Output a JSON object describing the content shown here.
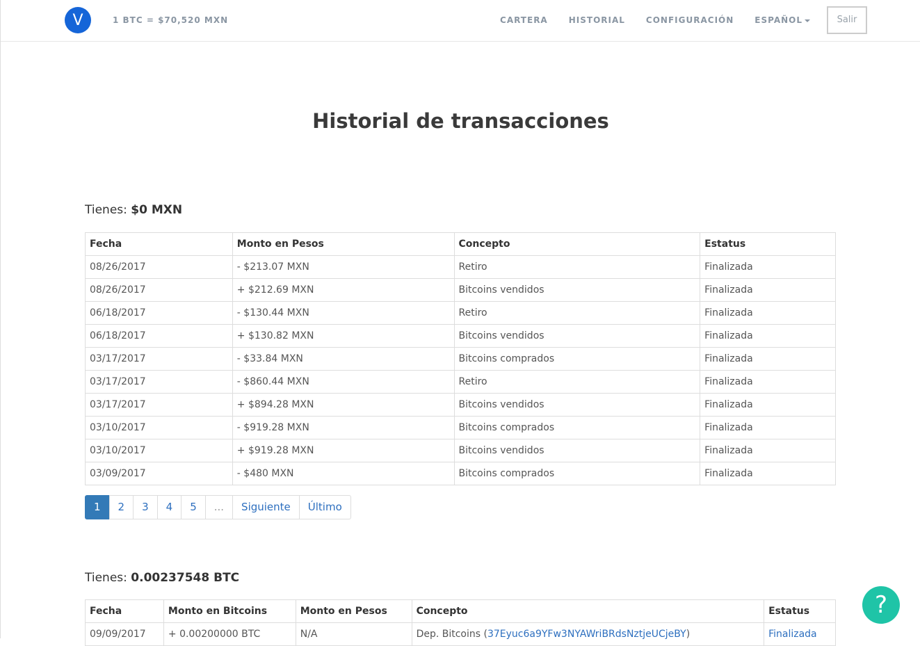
{
  "header": {
    "logo_letter": "V",
    "rate": "1 BTC = $70,520 MXN",
    "nav": {
      "wallet": "CARTERA",
      "history": "HISTORIAL",
      "settings": "CONFIGURACIÓN",
      "language": "ESPAÑOL"
    },
    "logout": "Salir"
  },
  "page": {
    "title": "Historial de transacciones"
  },
  "mxn": {
    "balance_label": "Tienes:",
    "balance_value": "$0 MXN",
    "columns": [
      "Fecha",
      "Monto en Pesos",
      "Concepto",
      "Estatus"
    ],
    "rows": [
      [
        "08/26/2017",
        "- $213.07 MXN",
        "Retiro",
        "Finalizada"
      ],
      [
        "08/26/2017",
        "+ $212.69 MXN",
        "Bitcoins vendidos",
        "Finalizada"
      ],
      [
        "06/18/2017",
        "- $130.44 MXN",
        "Retiro",
        "Finalizada"
      ],
      [
        "06/18/2017",
        "+ $130.82 MXN",
        "Bitcoins vendidos",
        "Finalizada"
      ],
      [
        "03/17/2017",
        "- $33.84 MXN",
        "Bitcoins comprados",
        "Finalizada"
      ],
      [
        "03/17/2017",
        "- $860.44 MXN",
        "Retiro",
        "Finalizada"
      ],
      [
        "03/17/2017",
        "+ $894.28 MXN",
        "Bitcoins vendidos",
        "Finalizada"
      ],
      [
        "03/10/2017",
        "- $919.28 MXN",
        "Bitcoins comprados",
        "Finalizada"
      ],
      [
        "03/10/2017",
        "+ $919.28 MXN",
        "Bitcoins vendidos",
        "Finalizada"
      ],
      [
        "03/09/2017",
        "- $480 MXN",
        "Bitcoins comprados",
        "Finalizada"
      ]
    ]
  },
  "pagination": {
    "pages": [
      "1",
      "2",
      "3",
      "4",
      "5"
    ],
    "ellipsis": "...",
    "next": "Siguiente",
    "last": "Último",
    "current": "1"
  },
  "btc": {
    "balance_label": "Tienes:",
    "balance_value": "0.00237548 BTC",
    "columns": [
      "Fecha",
      "Monto en Bitcoins",
      "Monto en Pesos",
      "Concepto",
      "Estatus"
    ],
    "rows": [
      {
        "date": "09/09/2017",
        "btc": "+ 0.00200000 BTC",
        "mxn": "N/A",
        "concept_prefix": "Dep. Bitcoins (",
        "concept_link": "37Eyuc6a9YFw3NYAWriBRdsNztjeUCjeBY",
        "concept_suffix": ")",
        "status": "Finalizada"
      }
    ]
  },
  "help": {
    "icon": "question-icon",
    "glyph": "?"
  },
  "colors": {
    "accent": "#337ab7",
    "logo": "#1565d8",
    "help": "#1fc4a7",
    "nav_text": "#8a96a3"
  }
}
